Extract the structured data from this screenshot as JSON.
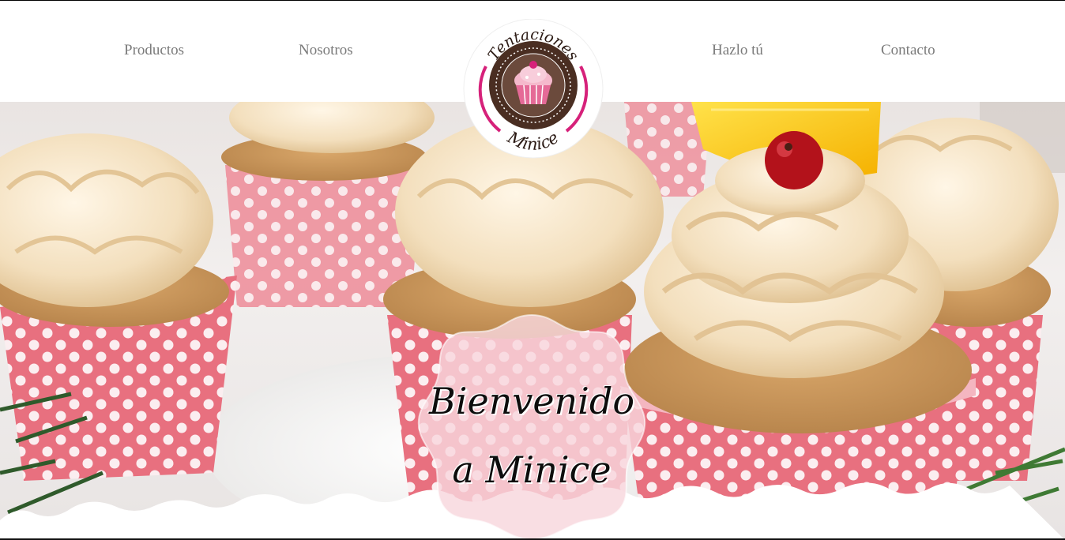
{
  "nav": {
    "left": [
      {
        "label": "Productos"
      },
      {
        "label": "Nosotros"
      }
    ],
    "right": [
      {
        "label": "Hazlo tú"
      },
      {
        "label": "Contacto"
      }
    ]
  },
  "logo": {
    "top_text": "Tentaciones",
    "bottom_text": "Minice",
    "icon": "cupcake-icon"
  },
  "hero": {
    "welcome_line1": "Bienvenido",
    "welcome_line2": "a Minice",
    "image": "pink-polka-dot-cupcakes-photo"
  },
  "colors": {
    "nav_text": "#7a7a7a",
    "logo_magenta": "#d6217a",
    "logo_brown": "#4a2e22",
    "cup_pink": "#e8707f",
    "frosting": "#f3dfbd",
    "badge_pink": "#f8d7dd"
  }
}
